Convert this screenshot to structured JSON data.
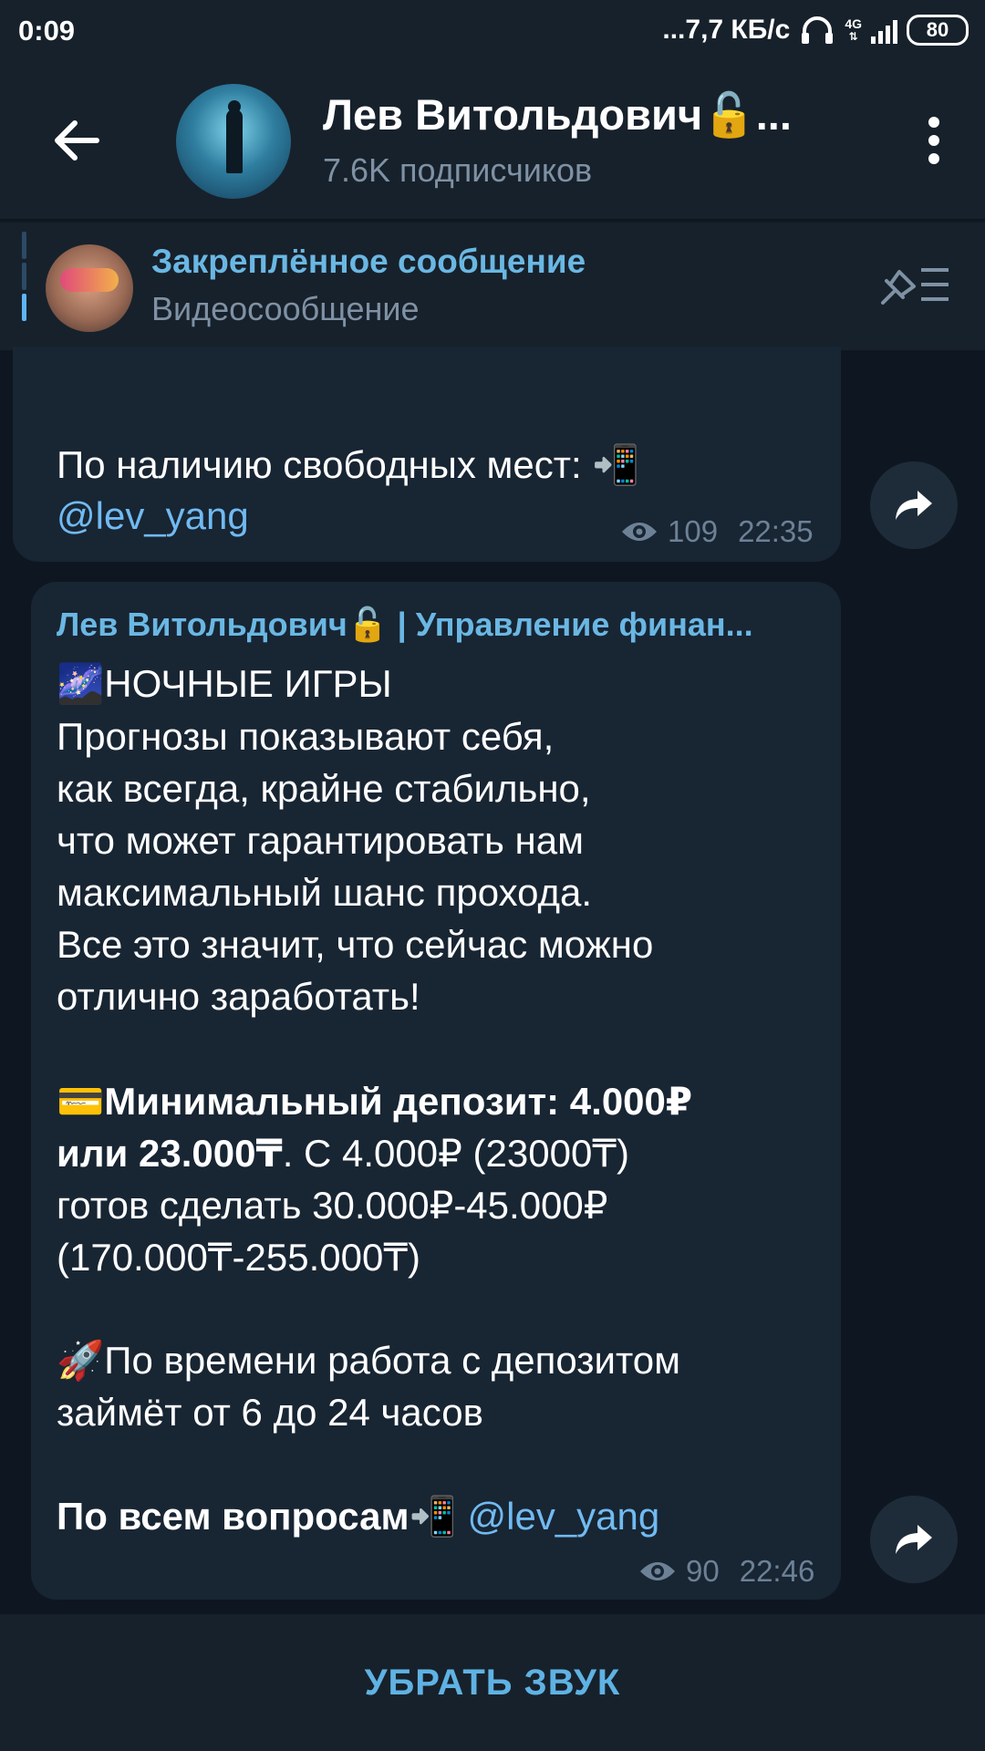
{
  "status_bar": {
    "time": "0:09",
    "network_speed": "...7,7 КБ/с",
    "network_type": "4G",
    "battery": "80",
    "icons": [
      "headphones-icon",
      "signal-icon",
      "battery-icon"
    ]
  },
  "header": {
    "title": "Лев Витольдович🔓...",
    "subscribers": "7.6K подписчиков",
    "icons": [
      "back-arrow-icon",
      "channel-avatar",
      "more-vertical-icon"
    ]
  },
  "pinned": {
    "title": "Закреплённое сообщение",
    "text": "Видеосообщение",
    "icons": [
      "pinned-list-icon"
    ]
  },
  "messages": [
    {
      "lines": [
        {
          "text": "По наличию свободных мест: 📲"
        },
        {
          "text": "@lev_yang",
          "link": true
        }
      ],
      "views": "109",
      "time": "22:35"
    },
    {
      "sender": "Лев Витольдович🔓 | Управление финан...",
      "title": "🌌НОЧНЫЕ ИГРЫ",
      "para1": [
        " Прогнозы показывают себя,",
        "как всегда, крайне стабильно,",
        "что может гарантировать нам",
        "максимальный шанс прохода.",
        "Все это значит, что сейчас можно",
        "отлично заработать!"
      ],
      "deposit_line1": "💳Минимальный депозит: 4.000₽",
      "deposit_line2_bold": "или 23.000₸",
      "deposit_line2_rest": ". С 4.000₽ (23000₸)",
      "deposit_line3": "готов сделать 30.000₽-45.000₽",
      "deposit_line4": "(170.000₸-255.000₸)",
      "time_line1": "🚀По времени работа с депозитом",
      "time_line2": "займёт от 6 до 24 часов",
      "questions_label": "По всем вопросам📲",
      "questions_link": "@lev_yang",
      "views": "90",
      "time": "22:46"
    }
  ],
  "bottom": {
    "button_label": "УБРАТЬ ЗВУК"
  }
}
